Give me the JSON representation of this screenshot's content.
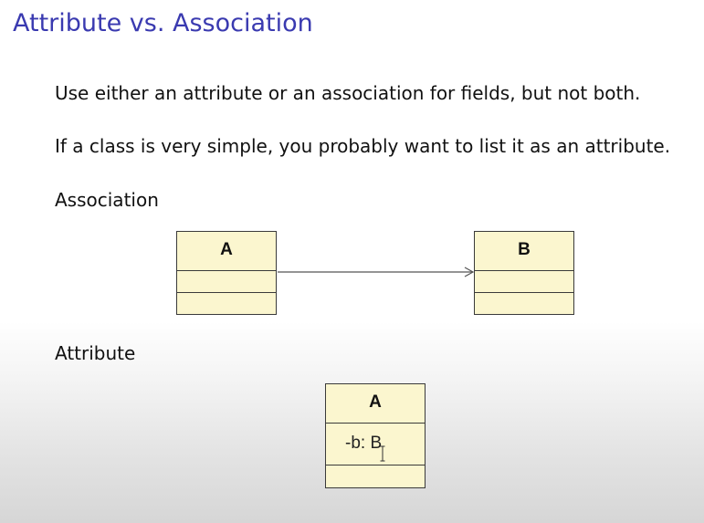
{
  "slide": {
    "title": "Attribute vs. Association",
    "line_1": "Use either an attribute or an association for fields, but not both.",
    "line_2": "If a class is very simple, you probably want to list it as an attribute."
  },
  "association_section": {
    "label": "Association",
    "class_a_name": "A",
    "class_b_name": "B"
  },
  "attribute_section": {
    "label": "Attribute",
    "class_name": "A",
    "attribute": "-b: B"
  },
  "colors": {
    "title": "#3a3ab0",
    "class_fill": "#fbf6cf",
    "class_border": "#3a3a3a"
  },
  "icons": {
    "arrow": "open-arrow-icon",
    "cursor": "text-cursor-icon"
  }
}
